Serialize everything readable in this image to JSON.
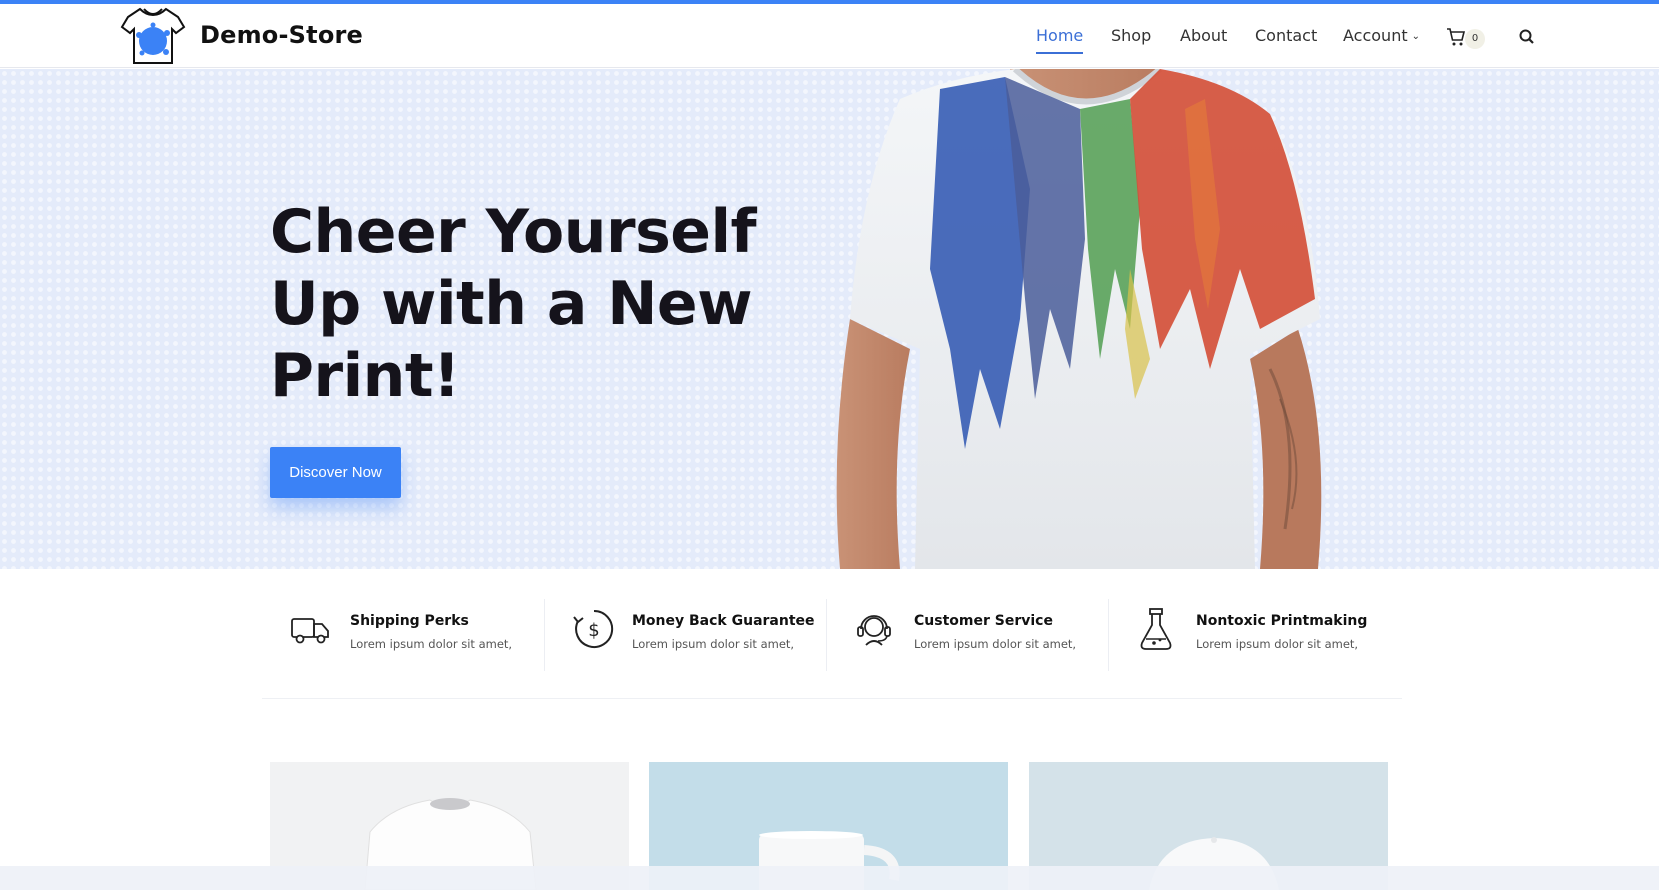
{
  "header": {
    "brand": "Demo-Store",
    "nav": {
      "home": "Home",
      "shop": "Shop",
      "about": "About",
      "contact": "Contact",
      "account": "Account"
    },
    "cart_count": "0",
    "icons": {
      "logo": "tshirt-splash-logo",
      "cart": "cart-icon",
      "search": "search-icon",
      "account_dropdown": "chevron-down-icon"
    }
  },
  "hero": {
    "title_lines": [
      "Cheer Yourself",
      "Up with a New",
      "Print!"
    ],
    "cta": "Discover Now",
    "image": "man-in-paint-splash-tshirt"
  },
  "features": [
    {
      "icon": "truck-icon",
      "title": "Shipping Perks",
      "text": "Lorem ipsum dolor sit amet,"
    },
    {
      "icon": "money-back-icon",
      "title": "Money Back Guarantee",
      "text": "Lorem ipsum dolor sit amet,"
    },
    {
      "icon": "headset-icon",
      "title": "Customer Service",
      "text": "Lorem ipsum dolor sit amet,"
    },
    {
      "icon": "flask-icon",
      "title": "Nontoxic Printmaking",
      "text": "Lorem ipsum dolor sit amet,"
    }
  ],
  "products": [
    {
      "image": "white-tshirt"
    },
    {
      "image": "white-mug"
    },
    {
      "image": "white-cap"
    }
  ],
  "colors": {
    "accent": "#3b82f6",
    "active_nav": "#3b6fd6",
    "hero_bg": "#e4ebfa",
    "text_dark": "#15131b"
  }
}
